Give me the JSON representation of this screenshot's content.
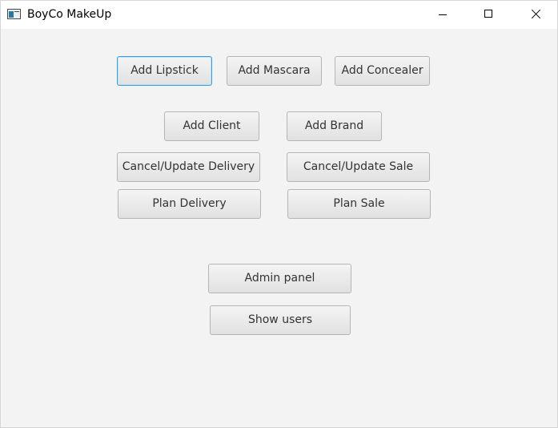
{
  "window": {
    "title": "BoyCo MakeUp"
  },
  "buttons": {
    "add_lipstick": "Add Lipstick",
    "add_mascara": "Add Mascara",
    "add_concealer": "Add Concealer",
    "add_client": "Add Client",
    "add_brand": "Add Brand",
    "cancel_update_delivery": "Cancel/Update Delivery",
    "cancel_update_sale": "Cancel/Update Sale",
    "plan_delivery": "Plan Delivery",
    "plan_sale": "Plan Sale",
    "admin_panel": "Admin panel",
    "show_users": "Show users"
  },
  "icons": {
    "app": "app-window-icon",
    "minimize": "minimize-icon",
    "maximize": "maximize-icon",
    "close": "close-icon"
  },
  "focused_button": "add_lipstick"
}
